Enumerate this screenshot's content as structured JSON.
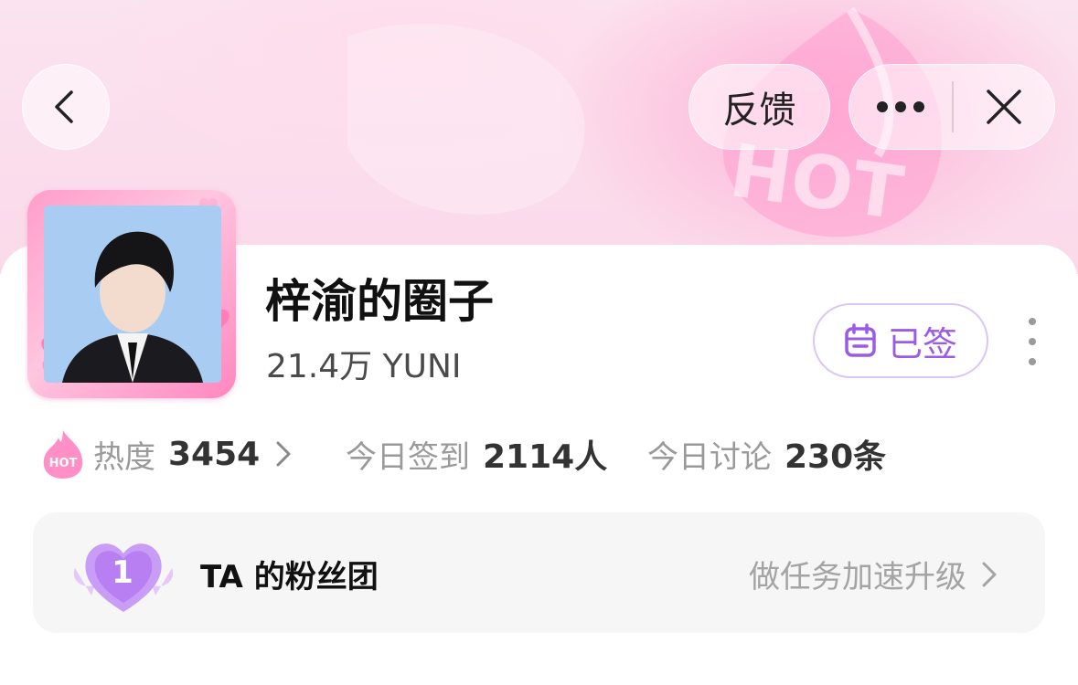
{
  "header": {
    "feedback_label": "反馈",
    "back_icon": "chevron-left-icon",
    "more_icon": "more-dots-icon",
    "close_icon": "close-icon"
  },
  "banner": {
    "badge_text": "HOT"
  },
  "profile": {
    "title": "梓渝的圈子",
    "subtitle": "21.4万 YUNI",
    "signed_label": "已签",
    "signed_icon": "calendar-icon"
  },
  "stats": {
    "heat_badge": "HOT",
    "heat_label": "热度",
    "heat_value": "3454",
    "checkin_label": "今日签到",
    "checkin_value": "2114人",
    "discussion_label": "今日讨论",
    "discussion_value": "230条"
  },
  "fans": {
    "level": "1",
    "title": "TA 的粉丝团",
    "action": "做任务加速升级"
  },
  "colors": {
    "accent_purple": "#9a5ce6",
    "pink": "#ff8cc3"
  }
}
